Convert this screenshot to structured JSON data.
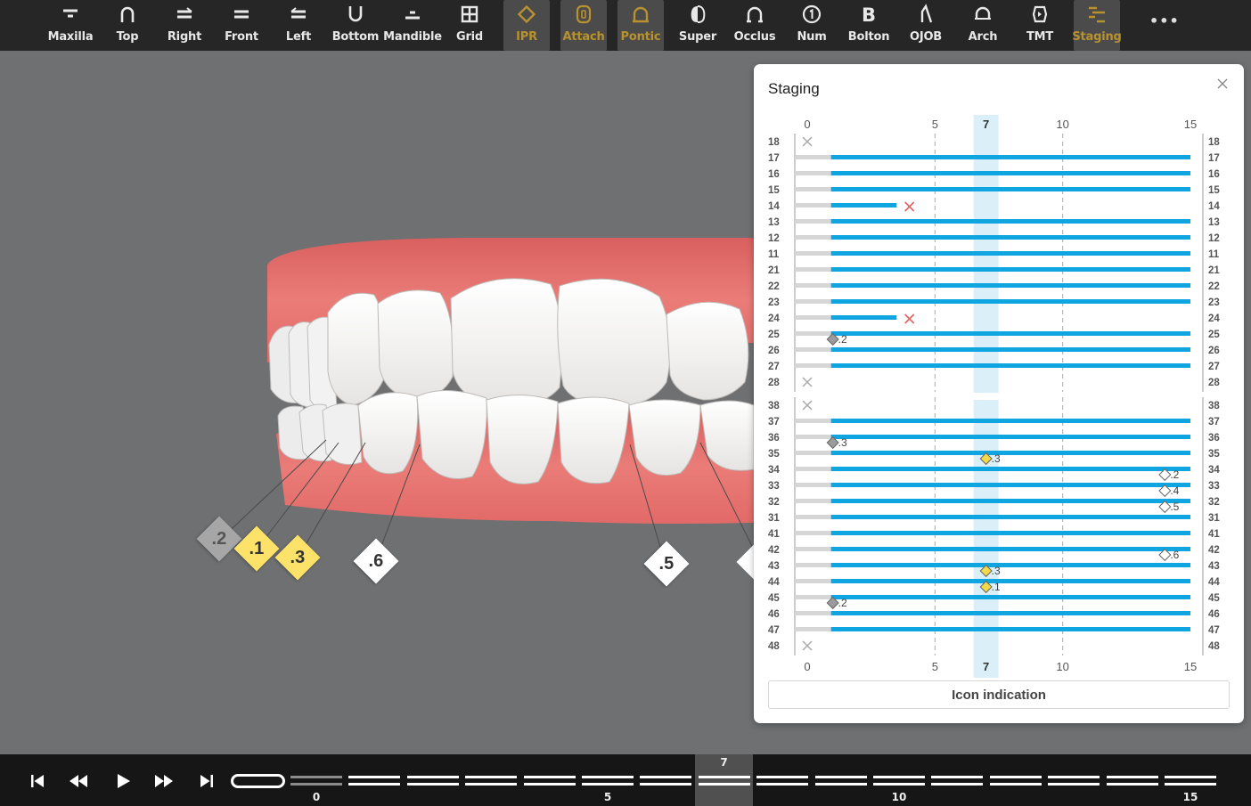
{
  "toolbar": {
    "tools": [
      {
        "label": "Maxilla",
        "icon": "maxilla-icon",
        "state": "normal"
      },
      {
        "label": "Top",
        "icon": "top-view-icon",
        "state": "normal"
      },
      {
        "label": "Right",
        "icon": "right-view-icon",
        "state": "normal"
      },
      {
        "label": "Front",
        "icon": "front-view-icon",
        "state": "normal"
      },
      {
        "label": "Left",
        "icon": "left-view-icon",
        "state": "normal"
      },
      {
        "label": "Bottom",
        "icon": "bottom-view-icon",
        "state": "normal"
      },
      {
        "label": "Mandible",
        "icon": "mandible-icon",
        "state": "normal"
      },
      {
        "label": "Grid",
        "icon": "grid-icon",
        "state": "normal"
      },
      {
        "label": "IPR",
        "icon": "ipr-icon",
        "state": "active"
      },
      {
        "label": "Attach",
        "icon": "attach-icon",
        "state": "active"
      },
      {
        "label": "Pontic",
        "icon": "pontic-icon",
        "state": "active"
      },
      {
        "label": "Super",
        "icon": "superimpose-icon",
        "state": "normal"
      },
      {
        "label": "Occlus",
        "icon": "occlusion-icon",
        "state": "normal"
      },
      {
        "label": "Num",
        "icon": "numbering-icon",
        "state": "normal"
      },
      {
        "label": "Bolton",
        "icon": "bolton-icon",
        "state": "normal"
      },
      {
        "label": "OJOB",
        "icon": "ojob-icon",
        "state": "normal"
      },
      {
        "label": "Arch",
        "icon": "arch-icon",
        "state": "normal"
      },
      {
        "label": "TMT",
        "icon": "tmt-icon",
        "state": "normal"
      },
      {
        "label": "Staging",
        "icon": "staging-icon",
        "state": "active"
      }
    ],
    "more_label": "•••"
  },
  "viewport": {
    "ipr_labels": [
      {
        "text": ".2",
        "color": "gray"
      },
      {
        "text": ".1",
        "color": "yellow"
      },
      {
        "text": ".3",
        "color": "yellow"
      },
      {
        "text": ".6",
        "color": "white"
      },
      {
        "text": ".5",
        "color": "white"
      }
    ]
  },
  "staging_panel": {
    "title": "Staging",
    "close_icon": "close-icon",
    "current_stage": 7,
    "axis_ticks": [
      "0",
      "5",
      "7",
      "10",
      "15"
    ],
    "button_label": "Icon indication",
    "colors": {
      "bar": "#0fa5e1",
      "highlight": "#dbeff9",
      "missing": "#e56060",
      "ipr_gray": "#9b9b9b",
      "ipr_yellow": "#f5d94a"
    },
    "upper": [
      {
        "tooth": "18",
        "status": "absent"
      },
      {
        "tooth": "17",
        "status": "move",
        "end": 15
      },
      {
        "tooth": "16",
        "status": "move",
        "end": 15
      },
      {
        "tooth": "15",
        "status": "move",
        "end": 15
      },
      {
        "tooth": "14",
        "status": "extract",
        "end": 3.5,
        "extract_at": 4
      },
      {
        "tooth": "13",
        "status": "move",
        "end": 15
      },
      {
        "tooth": "12",
        "status": "move",
        "end": 15
      },
      {
        "tooth": "11",
        "status": "move",
        "end": 15
      },
      {
        "tooth": "21",
        "status": "move",
        "end": 15
      },
      {
        "tooth": "22",
        "status": "move",
        "end": 15
      },
      {
        "tooth": "23",
        "status": "move",
        "end": 15
      },
      {
        "tooth": "24",
        "status": "extract",
        "end": 3.5,
        "extract_at": 4
      },
      {
        "tooth": "25",
        "status": "move",
        "end": 15,
        "ipr": [
          {
            "stage": 1,
            "value": ".2",
            "kind": "gray"
          }
        ]
      },
      {
        "tooth": "26",
        "status": "move",
        "end": 15
      },
      {
        "tooth": "27",
        "status": "move",
        "end": 15
      },
      {
        "tooth": "28",
        "status": "absent"
      }
    ],
    "lower": [
      {
        "tooth": "38",
        "status": "absent"
      },
      {
        "tooth": "37",
        "status": "move",
        "end": 15
      },
      {
        "tooth": "36",
        "status": "move",
        "end": 15,
        "ipr": [
          {
            "stage": 1,
            "value": ".3",
            "kind": "gray"
          }
        ]
      },
      {
        "tooth": "35",
        "status": "move",
        "end": 15,
        "ipr": [
          {
            "stage": 7,
            "value": ".3",
            "kind": "yellow"
          }
        ]
      },
      {
        "tooth": "34",
        "status": "move",
        "end": 15,
        "ipr": [
          {
            "stage": 14,
            "value": ".2",
            "kind": "white"
          }
        ]
      },
      {
        "tooth": "33",
        "status": "move",
        "end": 15,
        "ipr": [
          {
            "stage": 14,
            "value": ".4",
            "kind": "white"
          }
        ]
      },
      {
        "tooth": "32",
        "status": "move",
        "end": 15,
        "ipr": [
          {
            "stage": 14,
            "value": ".5",
            "kind": "white"
          }
        ]
      },
      {
        "tooth": "31",
        "status": "move",
        "end": 15
      },
      {
        "tooth": "41",
        "status": "move",
        "end": 15
      },
      {
        "tooth": "42",
        "status": "move",
        "end": 15,
        "ipr": [
          {
            "stage": 14,
            "value": ".6",
            "kind": "white"
          }
        ]
      },
      {
        "tooth": "43",
        "status": "move",
        "end": 15,
        "ipr": [
          {
            "stage": 7,
            "value": ".3",
            "kind": "yellow"
          }
        ]
      },
      {
        "tooth": "44",
        "status": "move",
        "end": 15,
        "ipr": [
          {
            "stage": 7,
            "value": ".1",
            "kind": "yellow"
          }
        ]
      },
      {
        "tooth": "45",
        "status": "move",
        "end": 15,
        "ipr": [
          {
            "stage": 1,
            "value": ".2",
            "kind": "gray"
          }
        ]
      },
      {
        "tooth": "46",
        "status": "move",
        "end": 15
      },
      {
        "tooth": "47",
        "status": "move",
        "end": 15
      },
      {
        "tooth": "48",
        "status": "absent"
      }
    ]
  },
  "timeline": {
    "current_stage_label": "7",
    "tick_labels": [
      "0",
      "5",
      "10",
      "15"
    ],
    "controls": [
      {
        "name": "skip-to-start-icon"
      },
      {
        "name": "step-back-icon"
      },
      {
        "name": "play-icon"
      },
      {
        "name": "step-forward-icon"
      },
      {
        "name": "skip-to-end-icon"
      }
    ]
  }
}
